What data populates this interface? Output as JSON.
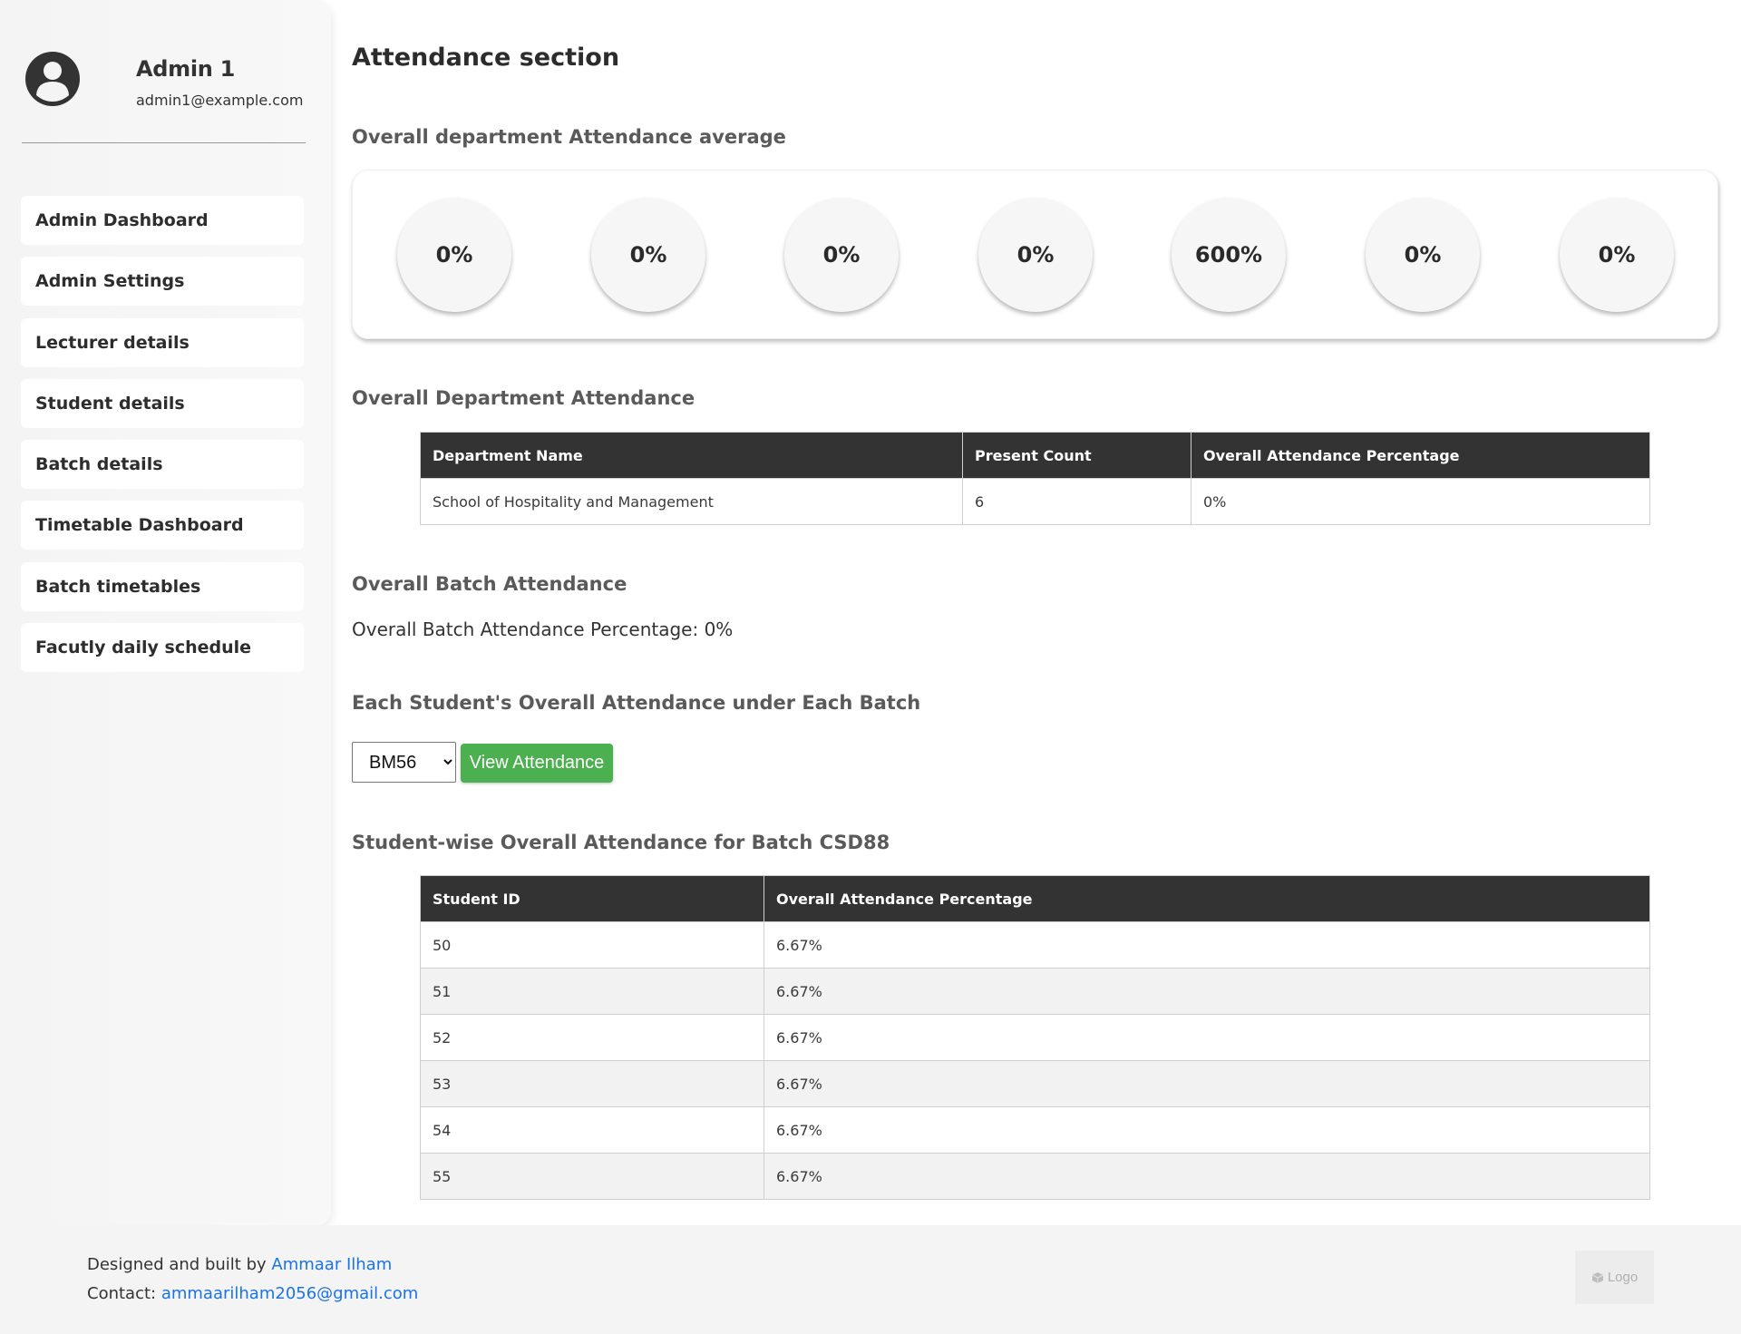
{
  "sidebar": {
    "profile": {
      "name": "Admin 1",
      "email": "admin1@example.com",
      "avatar_icon": "user-circle-icon"
    },
    "items": [
      {
        "label": "Admin Dashboard"
      },
      {
        "label": "Admin Settings"
      },
      {
        "label": "Lecturer details"
      },
      {
        "label": "Student details"
      },
      {
        "label": "Batch details"
      },
      {
        "label": "Timetable Dashboard"
      },
      {
        "label": "Batch timetables"
      },
      {
        "label": "Facutly daily schedule"
      }
    ]
  },
  "main": {
    "title": "Attendance section",
    "average_section": {
      "heading": "Overall department Attendance average",
      "circles": [
        "0%",
        "0%",
        "0%",
        "0%",
        "600%",
        "0%",
        "0%"
      ]
    },
    "department_section": {
      "heading": "Overall Department Attendance",
      "columns": [
        "Department Name",
        "Present Count",
        "Overall Attendance Percentage"
      ],
      "rows": [
        [
          "School of Hospitality and Management",
          "6",
          "0%"
        ]
      ]
    },
    "batch_section": {
      "heading": "Overall Batch Attendance",
      "text": "Overall Batch Attendance Percentage: 0%"
    },
    "student_filter": {
      "heading": "Each Student's Overall Attendance under Each Batch",
      "selected_batch": "BM56",
      "button_label": "View Attendance",
      "button_color": "#4caf50"
    },
    "student_section": {
      "heading": "Student-wise Overall Attendance for Batch CSD88",
      "columns": [
        "Student ID",
        "Overall Attendance Percentage"
      ],
      "rows": [
        [
          "50",
          "6.67%"
        ],
        [
          "51",
          "6.67%"
        ],
        [
          "52",
          "6.67%"
        ],
        [
          "53",
          "6.67%"
        ],
        [
          "54",
          "6.67%"
        ],
        [
          "55",
          "6.67%"
        ]
      ]
    }
  },
  "footer": {
    "designed_prefix": "Designed and built by ",
    "author": "Ammaar Ilham",
    "contact_prefix": "Contact: ",
    "email": "ammaarilham2056@gmail.com",
    "logo_label": "Logo",
    "link_color": "#1a73e8"
  }
}
